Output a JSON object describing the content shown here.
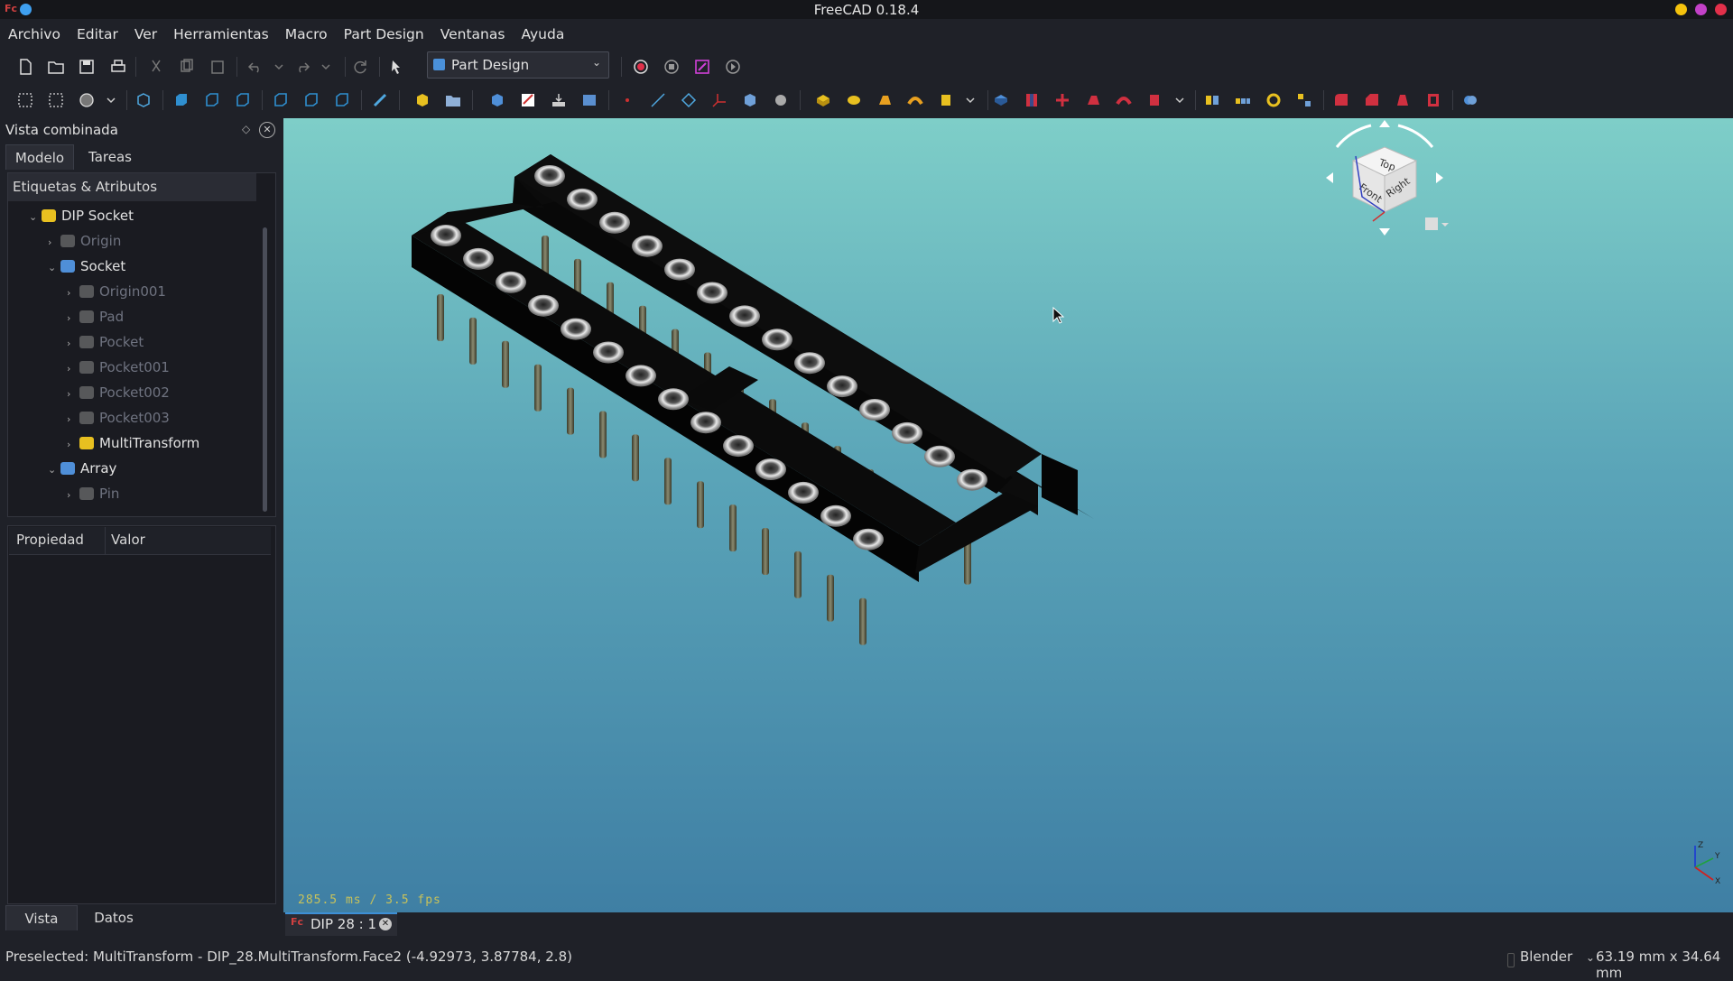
{
  "window": {
    "title": "FreeCAD 0.18.4"
  },
  "menu": [
    "Archivo",
    "Editar",
    "Ver",
    "Herramientas",
    "Macro",
    "Part Design",
    "Ventanas",
    "Ayuda"
  ],
  "toolbar": {
    "workbench": "Part Design"
  },
  "combo": {
    "title": "Vista combinada",
    "tabs": [
      "Modelo",
      "Tareas"
    ],
    "tree_header": "Etiquetas & Atributos",
    "tree": [
      {
        "label": "DIP Socket",
        "icon": "part-icon",
        "state": "expanded",
        "level": 1,
        "visible": true
      },
      {
        "label": "Origin",
        "icon": "origin-icon",
        "state": "collapsed",
        "level": 2,
        "visible": false
      },
      {
        "label": "Socket",
        "icon": "body-icon",
        "state": "expanded",
        "level": 2,
        "visible": true
      },
      {
        "label": "Origin001",
        "icon": "origin-icon",
        "state": "collapsed",
        "level": 3,
        "visible": false
      },
      {
        "label": "Pad",
        "icon": "pad-icon",
        "state": "collapsed",
        "level": 3,
        "visible": false
      },
      {
        "label": "Pocket",
        "icon": "pocket-icon",
        "state": "collapsed",
        "level": 3,
        "visible": false
      },
      {
        "label": "Pocket001",
        "icon": "pocket-icon",
        "state": "collapsed",
        "level": 3,
        "visible": false
      },
      {
        "label": "Pocket002",
        "icon": "pocket-icon",
        "state": "collapsed",
        "level": 3,
        "visible": false
      },
      {
        "label": "Pocket003",
        "icon": "pocket-icon",
        "state": "collapsed",
        "level": 3,
        "visible": false
      },
      {
        "label": "MultiTransform",
        "icon": "multitransform-icon",
        "state": "collapsed",
        "level": 3,
        "visible": true
      },
      {
        "label": "Array",
        "icon": "array-icon",
        "state": "expanded",
        "level": 2,
        "visible": true
      },
      {
        "label": "Pin",
        "icon": "pin-icon",
        "state": "collapsed",
        "level": 3,
        "visible": false
      }
    ],
    "prop_columns": [
      "Propiedad",
      "Valor"
    ],
    "bottom_tabs": [
      "Vista",
      "Datos"
    ]
  },
  "view": {
    "fps": "285.5 ms / 3.5 fps",
    "navcube": {
      "top": "Top",
      "front": "Front",
      "right": "Right"
    },
    "axes": {
      "x": "X",
      "y": "Y",
      "z": "Z"
    }
  },
  "document_tab": "DIP 28 : 1",
  "status": {
    "text": "Preselected: MultiTransform - DIP_28.MultiTransform.Face2 (-4.92973, 3.87784, 2.8)",
    "nav_style": "Blender",
    "dimensions": "63.19 mm x 34.64 mm"
  },
  "colors": {
    "accent": "#3d8fd6",
    "bg_top": "#7ecec8",
    "bg_bottom": "#3f7fa4"
  }
}
